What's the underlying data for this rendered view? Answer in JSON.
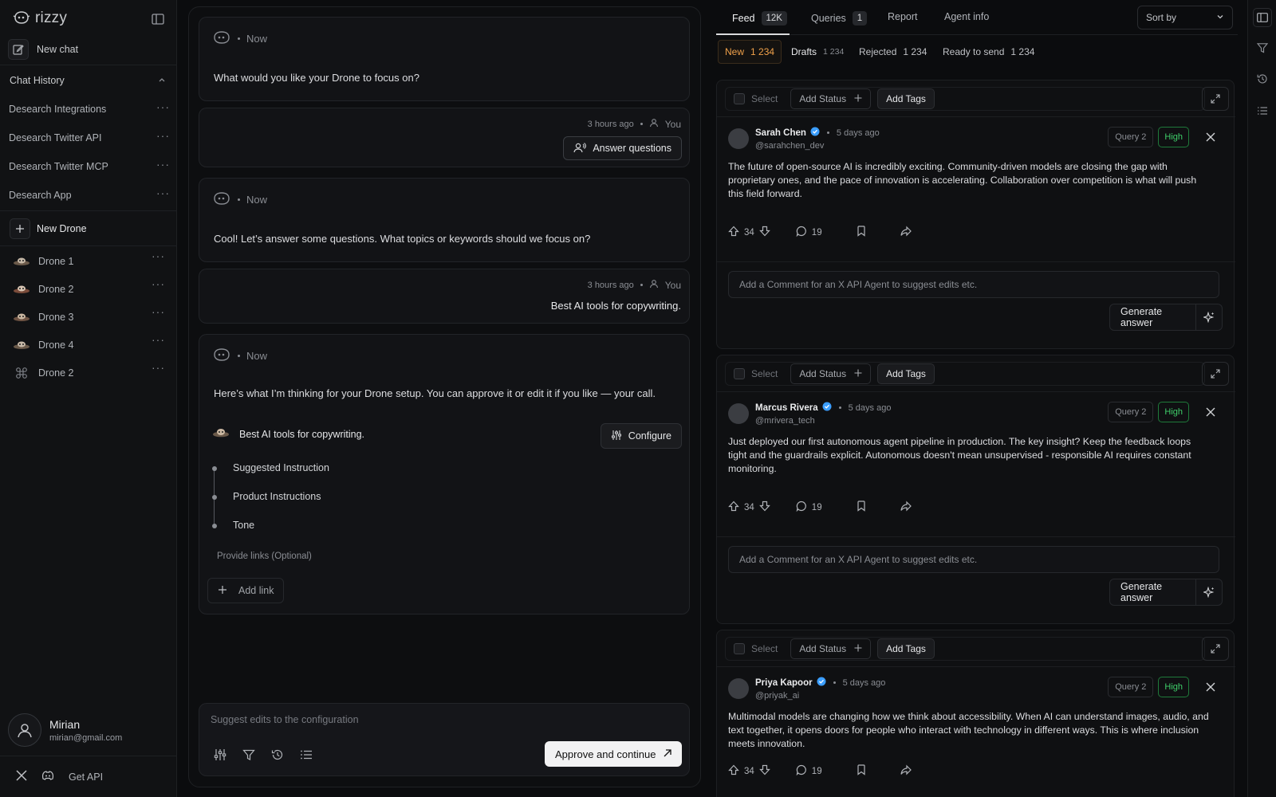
{
  "brand": {
    "name": "rizzy"
  },
  "sidebar": {
    "new_chat": "New chat",
    "chat_history_label": "Chat History",
    "history": [
      {
        "label": "Desearch Integrations"
      },
      {
        "label": "Desearch Twitter API"
      },
      {
        "label": "Desearch Twitter MCP"
      },
      {
        "label": "Desearch App"
      }
    ],
    "new_drone": "New Drone",
    "drones": [
      {
        "label": "Drone 1"
      },
      {
        "label": "Drone 2"
      },
      {
        "label": "Drone 3"
      },
      {
        "label": "Drone 4"
      },
      {
        "label": "Drone 2"
      }
    ],
    "user": {
      "name": "Mirian",
      "email": "mirian@gmail.com"
    },
    "get_api": "Get API"
  },
  "chat": {
    "messages": [
      {
        "time": "Now",
        "text": "What would you like your Drone to focus on?"
      },
      {
        "time": "3 hours ago",
        "author": "You",
        "button": "Answer questions"
      },
      {
        "time": "Now",
        "text": "Cool! Let’s answer some questions. What topics or keywords should we focus on?"
      },
      {
        "time": "3 hours ago",
        "author": "You",
        "text": "Best AI tools for copywriting."
      },
      {
        "time": "Now",
        "text": "Here’s what I’m thinking for your Drone setup. You can approve it or edit it if you like — your call."
      }
    ],
    "config": {
      "title": "Best AI tools for copywriting.",
      "configure": "Configure",
      "steps": [
        "Suggested Instruction",
        "Product Instructions",
        "Tone"
      ],
      "links_label": "Provide links (Optional)",
      "add_link": "Add link"
    },
    "composer": {
      "placeholder": "Suggest edits to the configuration",
      "approve": "Approve and continue"
    }
  },
  "feed": {
    "tabs": [
      {
        "label": "Feed",
        "badge": "12K"
      },
      {
        "label": "Queries",
        "badge": "1"
      },
      {
        "label": "Report"
      },
      {
        "label": "Agent info"
      }
    ],
    "sort_by": "Sort by",
    "subtabs": [
      {
        "label": "New",
        "count": "1 234"
      },
      {
        "label": "Drafts",
        "count": "1 234"
      },
      {
        "label": "Rejected",
        "count": "1 234"
      },
      {
        "label": "Ready to send",
        "count": "1 234"
      }
    ],
    "toolbar": {
      "select": "Select",
      "add_status": "Add Status",
      "add_tags": "Add Tags"
    },
    "posts": [
      {
        "name": "Sarah Chen",
        "handle": "@sarahchen_dev",
        "time": "5 days ago",
        "query": "Query 2",
        "priority": "High",
        "text": "The future of open-source AI is incredibly exciting. Community-driven models are closing the gap with proprietary ones, and the pace of innovation is accelerating. Collaboration over competition is what will push this field forward.",
        "votes": "34",
        "comments": "19"
      },
      {
        "name": "Marcus Rivera",
        "handle": "@mrivera_tech",
        "time": "5 days ago",
        "query": "Query 2",
        "priority": "High",
        "text": "Just deployed our first autonomous agent pipeline in production. The key insight? Keep the feedback loops tight and the guardrails explicit. Autonomous doesn't mean unsupervised - responsible AI requires constant monitoring.",
        "votes": "34",
        "comments": "19"
      },
      {
        "name": "Priya Kapoor",
        "handle": "@priyak_ai",
        "time": "5 days ago",
        "query": "Query 2",
        "priority": "High",
        "text": "Multimodal models are changing how we think about accessibility. When AI can understand images, audio, and text together, it opens doors for people who interact with technology in different ways. This is where inclusion meets innovation.",
        "votes": "34",
        "comments": "19"
      }
    ],
    "comment_placeholder": "Add a Comment for an X API Agent to suggest edits etc.",
    "generate_answer": "Generate answer"
  },
  "colors": {
    "accent_new": "#f0a14a",
    "high": "#3fcf6a",
    "verified": "#3b9eff"
  }
}
